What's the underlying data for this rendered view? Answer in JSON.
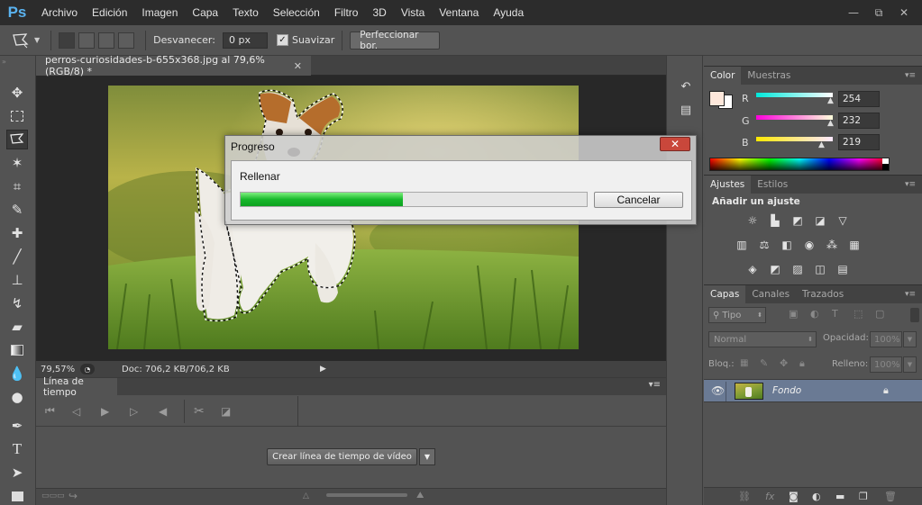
{
  "app": {
    "logo": "Ps"
  },
  "menu": [
    "Archivo",
    "Edición",
    "Imagen",
    "Capa",
    "Texto",
    "Selección",
    "Filtro",
    "3D",
    "Vista",
    "Ventana",
    "Ayuda"
  ],
  "window_controls": {
    "minimize": "—",
    "restore": "⧉",
    "close": "✕"
  },
  "options_bar": {
    "feather_label": "Desvanecer:",
    "feather_value": "0 px",
    "smooth_label": "Suavizar",
    "smooth_checked": true,
    "refine_button": "Perfeccionar bor."
  },
  "document": {
    "tab_title": "perros-curiosidades-b-655x368.jpg al 79,6% (RGB/8) *",
    "zoom": "79,57%",
    "doc_info": "Doc: 706,2 KB/706,2 KB"
  },
  "dialog": {
    "title": "Progreso",
    "task": "Rellenar",
    "progress": 0.47,
    "cancel_label": "Cancelar",
    "close_glyph": "✕"
  },
  "timeline": {
    "tab": "Línea de tiempo",
    "create_button": "Crear línea de tiempo de vídeo"
  },
  "color_panel": {
    "tabs": [
      "Color",
      "Muestras"
    ],
    "r_label": "R",
    "g_label": "G",
    "b_label": "B",
    "r": "254",
    "g": "232",
    "b": "219",
    "foreground": "#fee8db",
    "background": "#ffffff"
  },
  "adjustments_panel": {
    "tabs": [
      "Ajustes",
      "Estilos"
    ],
    "heading": "Añadir un ajuste"
  },
  "layers_panel": {
    "tabs": [
      "Capas",
      "Canales",
      "Trazados"
    ],
    "filter_kind": "Tipo",
    "blend_mode": "Normal",
    "opacity_label": "Opacidad:",
    "opacity_value": "100%",
    "lock_label": "Bloq.:",
    "fill_label": "Relleno:",
    "fill_value": "100%",
    "layers": [
      {
        "name": "Fondo",
        "visible": true,
        "locked": true
      }
    ]
  },
  "colors": {
    "accent_progress": "#18b82c",
    "menubar": "#2c2c2c",
    "panel": "#535353"
  }
}
